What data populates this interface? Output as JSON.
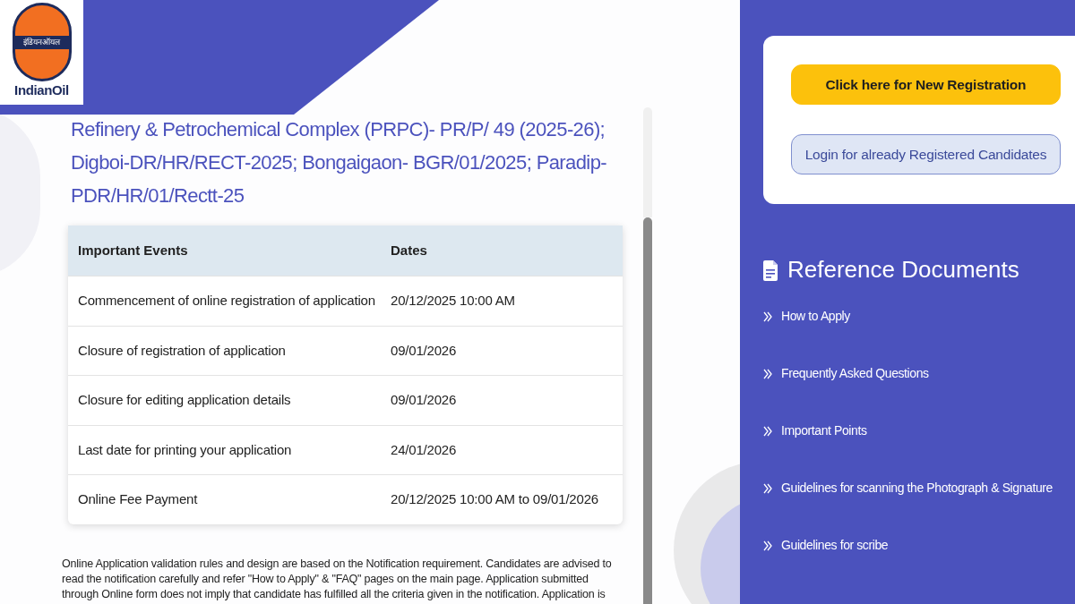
{
  "logo": {
    "script_text": "इंडियनऑयल",
    "wordmark": "IndianOil"
  },
  "title": "Refinery & Petrochemical Complex (PRPC)- PR/P/ 49 (2025-26); Digboi-DR/HR/RECT-2025; Bongaigaon- BGR/01/2025; Paradip-PDR/HR/01/Rectt-25",
  "events_table": {
    "columns": [
      "Important Events",
      "Dates"
    ],
    "rows": [
      [
        "Commencement of online registration of application",
        "20/12/2025 10:00 AM"
      ],
      [
        "Closure of registration of application",
        "09/01/2026"
      ],
      [
        "Closure for editing application details",
        "09/01/2026"
      ],
      [
        "Last date for printing your application",
        "24/01/2026"
      ],
      [
        "Online Fee Payment",
        "20/12/2025 10:00 AM to 09/01/2026"
      ]
    ]
  },
  "notice": "Online Application validation rules and design are based on the Notification requirement. Candidates are advised to read the notification carefully and refer \"How to Apply\" & \"FAQ\" pages on the main page. Application submitted through Online form does not imply that candidate has fulfilled all the criteria given in the notification. Application is",
  "registration": {
    "buttons": [
      {
        "label": "Click here for New Registration",
        "kind": "primary"
      },
      {
        "label": "Login for already Registered Candidates",
        "kind": "secondary"
      }
    ]
  },
  "reference_documents": {
    "title": "Reference Documents",
    "links": [
      "How to Apply",
      "Frequently Asked Questions",
      "Important Points",
      "Guidelines for scanning the Photograph & Signature",
      "Guidelines for scribe"
    ]
  }
}
